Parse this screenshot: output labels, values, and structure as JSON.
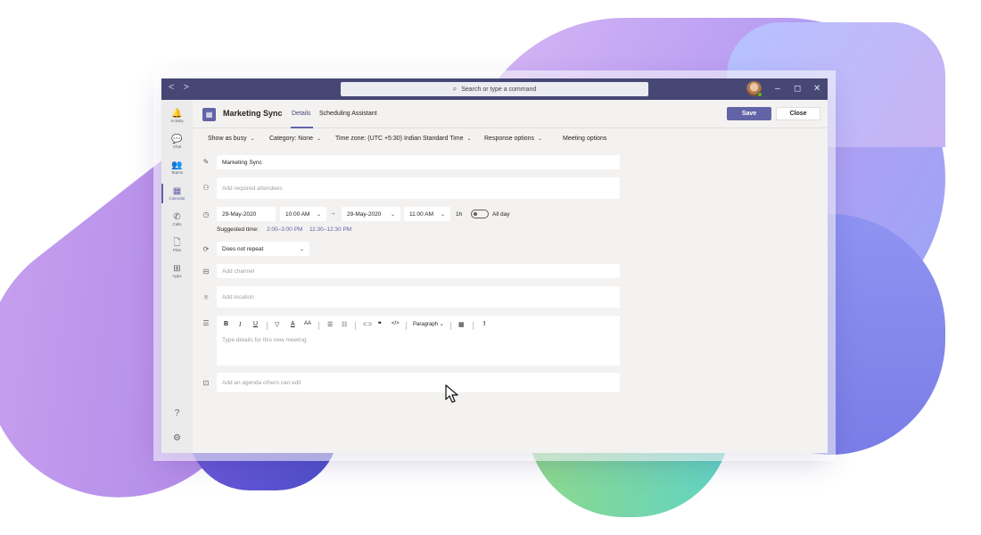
{
  "titlebar": {
    "nav_back": "<",
    "nav_forward": ">",
    "search_icon": "search-icon",
    "search_placeholder": "Search or type a command",
    "minimize": "–",
    "maximize": "◻",
    "close": "✕"
  },
  "rail": {
    "items": [
      {
        "label": "Activity",
        "icon": "bell-icon",
        "glyph": "🔔"
      },
      {
        "label": "Chat",
        "icon": "chat-icon",
        "glyph": "💬"
      },
      {
        "label": "Teams",
        "icon": "teams-icon",
        "glyph": "👥"
      },
      {
        "label": "Calendar",
        "icon": "calendar-icon",
        "glyph": "▦",
        "active": true
      },
      {
        "label": "Calls",
        "icon": "phone-icon",
        "glyph": "✆"
      },
      {
        "label": "Files",
        "icon": "file-icon",
        "glyph": "🗋"
      },
      {
        "label": "Apps",
        "icon": "apps-icon",
        "glyph": "⊞"
      }
    ],
    "help_glyph": "?",
    "settings_glyph": "⚙"
  },
  "header": {
    "title": "Marketing Sync",
    "tabs": [
      "Details",
      "Scheduling Assistant"
    ],
    "save_label": "Save",
    "close_label": "Close"
  },
  "options": {
    "show_as": "Show as busy",
    "category": "Category: None",
    "time_zone": "Time zone: (UTC +5:30) Indian Standard Time",
    "response": "Response options",
    "meeting_options": "Meeting options"
  },
  "form": {
    "title_value": "Marketing Sync",
    "attendees_placeholder": "Add required attendees",
    "start_date": "29-May-2020",
    "start_time": "10:00 AM",
    "arrow": "→",
    "end_date": "29-May-2020",
    "end_time": "11:00 AM",
    "duration": "1h",
    "all_day": "All day",
    "suggested_label": "Suggested time:",
    "suggested_1": "2:00–3:00 PM",
    "suggested_2": "11:30–12:30 PM",
    "repeat": "Does not repeat",
    "channel_placeholder": "Add channel",
    "location_placeholder": "Add location",
    "details_placeholder": "Type details for this new meeting",
    "agenda_placeholder": "Add an agenda others can edit"
  },
  "editor_toolbar": {
    "bold": "B",
    "italic": "I",
    "underline": "U",
    "highlight": "▽",
    "font_color": "A",
    "font_size": "AA",
    "bullets": "☰",
    "numbered": "☷",
    "link": "⊂⊃",
    "quote": "❞",
    "code": "</>",
    "paragraph": "Paragraph",
    "table": "▦",
    "important": "!"
  },
  "colors": {
    "brand": "#6264a7",
    "titlebar": "#464775",
    "presence": "#6bb700"
  }
}
